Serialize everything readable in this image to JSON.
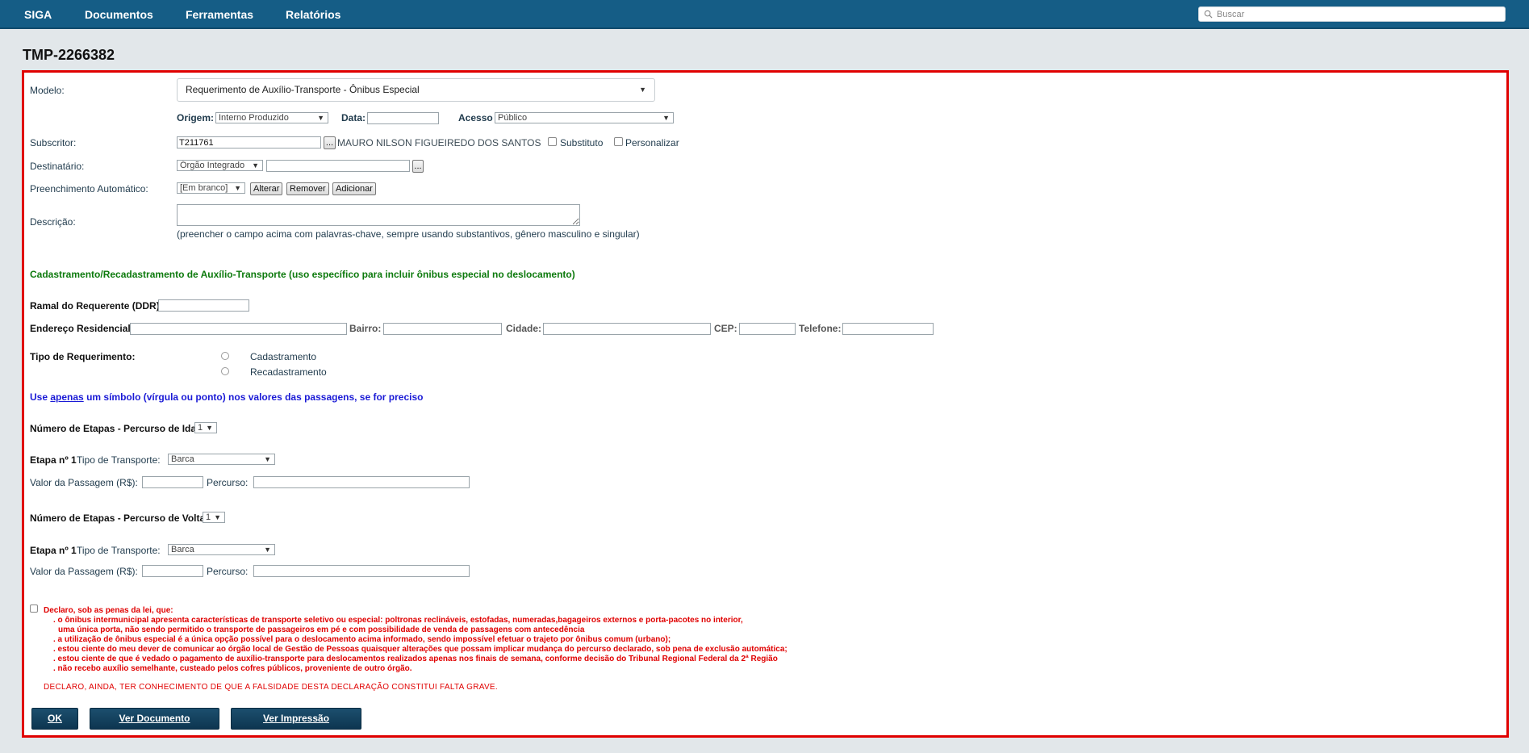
{
  "nav": {
    "items": [
      "SIGA",
      "Documentos",
      "Ferramentas",
      "Relatórios"
    ],
    "search_placeholder": "Buscar"
  },
  "doc_id": "TMP-2266382",
  "form": {
    "modelo_label": "Modelo:",
    "modelo_value": "Requerimento de Auxílio-Transporte - Ônibus Especial",
    "origem_label": "Origem:",
    "origem_value": "Interno Produzido",
    "data_label": "Data:",
    "acesso_label": "Acesso",
    "acesso_value": "Público",
    "subscritor_label": "Subscritor:",
    "subscritor_value": "T211761",
    "lookup_button": "...",
    "subscritor_name": "MAURO NILSON FIGUEIREDO DOS SANTOS",
    "substituto_label": "Substituto",
    "personalizar_label": "Personalizar",
    "destinatario_label": "Destinatário:",
    "destinatario_value": "Órgão Integrado",
    "preenchimento_label": "Preenchimento Automático:",
    "preenchimento_value": "[Em branco]",
    "alterar_button": "Alterar",
    "remover_button": "Remover",
    "adicionar_button": "Adicionar",
    "descricao_label": "Descrição:",
    "descricao_hint": "(preencher o campo acima com palavras-chave, sempre usando substantivos, gênero masculino e singular)"
  },
  "section_title": "Cadastramento/Recadastramento de Auxílio-Transporte (uso específico para incluir ônibus especial no deslocamento)",
  "fields": {
    "ramal_label": "Ramal do Requerente (DDR)",
    "endereco_label": "Endereço Residencial",
    "bairro_label": "Bairro:",
    "cidade_label": "Cidade:",
    "cep_label": "CEP:",
    "telefone_label": "Telefone:",
    "tipo_req_label": "Tipo de Requerimento:",
    "tipo_options": [
      "Cadastramento",
      "Recadastramento"
    ]
  },
  "hint": {
    "use": "Use",
    "apenas": "apenas",
    "rest": "um símbolo (vírgula ou ponto) nos valores das passagens, se for preciso"
  },
  "ida": {
    "etapas_label": "Número de Etapas - Percurso de Ida",
    "etapas_value": "1",
    "etapa_label": "Etapa nº 1",
    "tipo_transporte_label": "Tipo de Transporte:",
    "tipo_transporte_value": "Barca",
    "valor_label": "Valor da Passagem (R$):",
    "percurso_label": "Percurso:"
  },
  "volta": {
    "etapas_label": "Número de Etapas - Percurso de Volta",
    "etapas_value": "1",
    "etapa_label": "Etapa nº 1",
    "tipo_transporte_label": "Tipo de Transporte:",
    "tipo_transporte_value": "Barca",
    "valor_label": "Valor da Passagem (R$):",
    "percurso_label": "Percurso:"
  },
  "declaration": {
    "heading": "Declaro, sob as penas da lei, que:",
    "lines": [
      ". o ônibus intermunicipal apresenta características de transporte seletivo ou especial: poltronas reclináveis, estofadas, numeradas,bagageiros externos e porta-pacotes no interior,",
      "uma única porta, não sendo permitido o transporte de passageiros em pé e com possibilidade de venda de passagens com antecedência",
      ". a utilização de ônibus especial é a única opção possível para o deslocamento acima informado, sendo impossível efetuar o trajeto por ônibus comum (urbano);",
      ". estou ciente do meu dever de comunicar ao órgão local de Gestão de Pessoas quaisquer alterações que possam implicar mudança do percurso declarado, sob pena de exclusão automática;",
      ". estou ciente de que é vedado o pagamento de auxílio-transporte para deslocamentos realizados apenas nos finais de semana, conforme decisão do Tribunal Regional Federal da 2ª Região",
      ". não recebo auxílio semelhante, custeado pelos cofres públicos, proveniente de outro órgão."
    ],
    "final": "DECLARO, AINDA, TER CONHECIMENTO DE QUE A FALSIDADE DESTA DECLARAÇÃO CONSTITUI FALTA GRAVE."
  },
  "buttons": {
    "ok": "OK",
    "ver_documento": "Ver Documento",
    "ver_impressao": "Ver Impressão"
  },
  "colors": {
    "nav_bg": "#155d86",
    "panel_border": "#e00000",
    "section_green": "#0d7a0d",
    "hint_blue": "#1a1ad6",
    "declaration_red": "#e00000",
    "button_dark": "#0d3550"
  }
}
